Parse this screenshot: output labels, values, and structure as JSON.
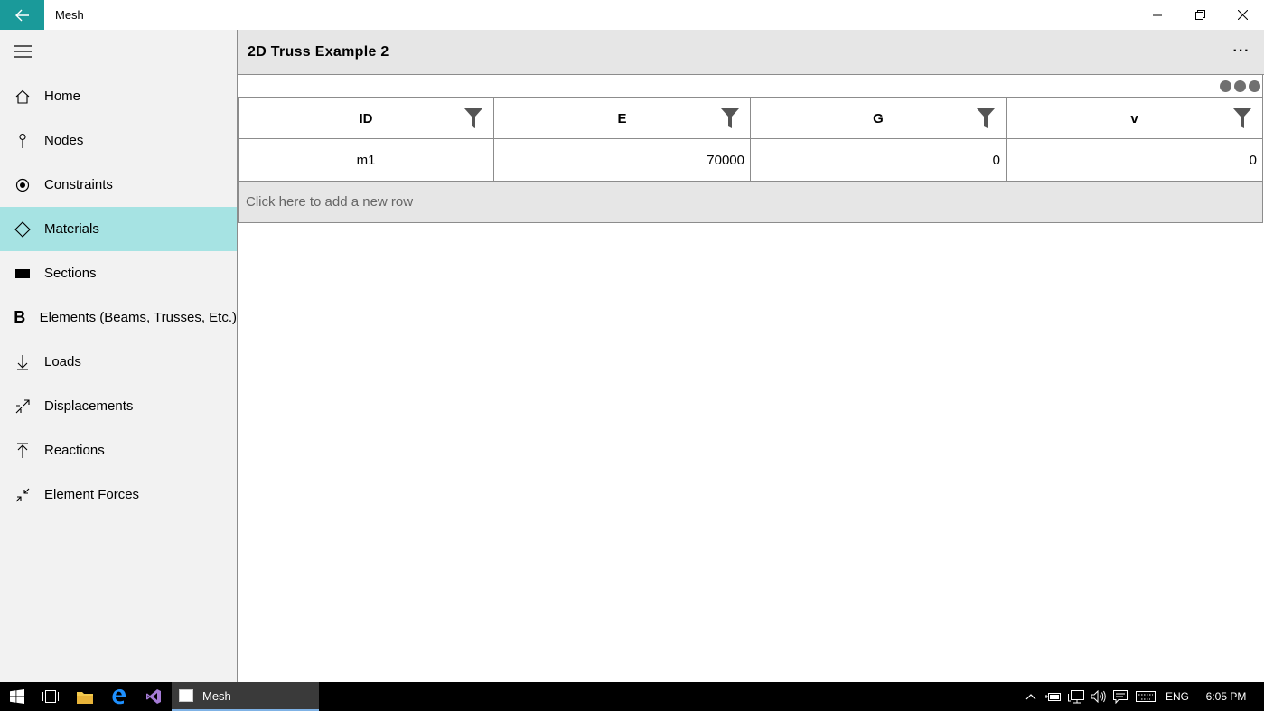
{
  "window": {
    "title": "Mesh"
  },
  "sidebar": {
    "items": [
      {
        "label": "Home",
        "icon": "home-icon"
      },
      {
        "label": "Nodes",
        "icon": "pin-icon"
      },
      {
        "label": "Constraints",
        "icon": "target-icon"
      },
      {
        "label": "Materials",
        "icon": "diamond-icon",
        "selected": true
      },
      {
        "label": "Sections",
        "icon": "rectangle-icon"
      },
      {
        "label": "Elements (Beams, Trusses, Etc.)",
        "icon": "bold-b-icon"
      },
      {
        "label": "Loads",
        "icon": "arrow-down-icon"
      },
      {
        "label": "Displacements",
        "icon": "displacement-icon"
      },
      {
        "label": "Reactions",
        "icon": "arrow-up-icon"
      },
      {
        "label": "Element Forces",
        "icon": "compress-arrows-icon"
      }
    ]
  },
  "main": {
    "title": "2D Truss Example 2",
    "more_label": "···"
  },
  "grid": {
    "columns": [
      "ID",
      "E",
      "G",
      "v"
    ],
    "rows": [
      {
        "id": "m1",
        "e": "70000",
        "g": "0",
        "v": "0"
      }
    ],
    "add_row_placeholder": "Click here to add a new row"
  },
  "taskbar": {
    "active_app": "Mesh",
    "language": "ENG",
    "time": "6:05 PM"
  },
  "colors": {
    "accent": "#1a9a9a",
    "selected_nav": "#a6e3e3",
    "sidebar_bg": "#f2f2f2",
    "header_bg": "#e6e6e6"
  }
}
